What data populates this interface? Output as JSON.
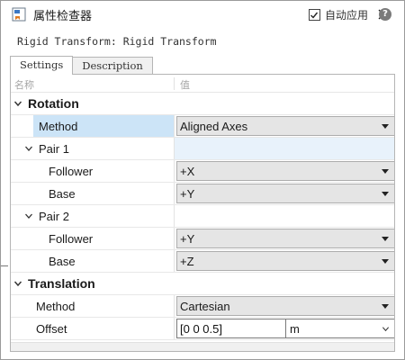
{
  "window": {
    "title": "属性检查器",
    "close_icon": "close-icon",
    "app_icon": "property-inspector-icon"
  },
  "header": {
    "block_path": "Rigid Transform: Rigid Transform",
    "auto_apply_label": "自动应用",
    "auto_apply_checked": true,
    "help_icon": "help-icon",
    "help_glyph": "?"
  },
  "tabs": [
    {
      "label": "Settings",
      "active": true
    },
    {
      "label": "Description",
      "active": false
    }
  ],
  "columns": {
    "name": "名称",
    "value": "值"
  },
  "rows": [
    {
      "kind": "group",
      "label": "Rotation",
      "expanded": true
    },
    {
      "kind": "param",
      "label": "Method",
      "value": "Aligned Axes",
      "control": "dropdown",
      "selected": true
    },
    {
      "kind": "subgroup",
      "label": "Pair 1",
      "expanded": true
    },
    {
      "kind": "param",
      "label": "Follower",
      "value": "+X",
      "control": "dropdown"
    },
    {
      "kind": "param",
      "label": "Base",
      "value": "+Y",
      "control": "dropdown"
    },
    {
      "kind": "subgroup",
      "label": "Pair 2",
      "expanded": true
    },
    {
      "kind": "param",
      "label": "Follower",
      "value": "+Y",
      "control": "dropdown"
    },
    {
      "kind": "param",
      "label": "Base",
      "value": "+Z",
      "control": "dropdown"
    },
    {
      "kind": "group",
      "label": "Translation",
      "expanded": true
    },
    {
      "kind": "param",
      "label": "Method",
      "value": "Cartesian",
      "control": "dropdown"
    },
    {
      "kind": "param",
      "label": "Offset",
      "value": "[0 0 0.5]",
      "unit": "m",
      "control": "input-unit"
    }
  ],
  "colors": {
    "selection": "#cce4f7",
    "subgroup_highlight": "#e8f2fb",
    "dropdown_bg": "#e5e5e5"
  }
}
